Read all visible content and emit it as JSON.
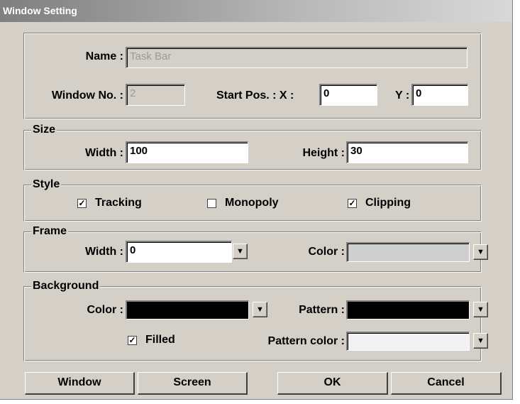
{
  "title": "Window Setting",
  "general": {
    "name_label": "Name :",
    "name_value": "Task Bar",
    "window_no_label": "Window No. :",
    "window_no_value": "2",
    "start_pos_label": "Start Pos. : X :",
    "x_value": "0",
    "y_label": "Y :",
    "y_value": "0"
  },
  "size": {
    "legend": "Size",
    "width_label": "Width :",
    "width_value": "100",
    "height_label": "Height :",
    "height_value": "30"
  },
  "style": {
    "legend": "Style",
    "tracking_label": "Tracking",
    "tracking_checked": true,
    "monopoly_label": "Monopoly",
    "monopoly_checked": false,
    "clipping_label": "Clipping",
    "clipping_checked": true
  },
  "frame": {
    "legend": "Frame",
    "width_label": "Width :",
    "width_value": "0",
    "color_label": "Color :"
  },
  "background": {
    "legend": "Background",
    "color_label": "Color :",
    "pattern_label": "Pattern :",
    "filled_label": "Filled",
    "filled_checked": true,
    "pattern_color_label": "Pattern color :",
    "color_swatch": "#000000",
    "pattern_swatch": "#000000",
    "pattern_color_swatch": "#f2f2f2"
  },
  "buttons": {
    "window": "Window",
    "screen": "Screen",
    "ok": "OK",
    "cancel": "Cancel"
  },
  "icons": {
    "checkmark": "✓",
    "dropdown": "▼"
  }
}
